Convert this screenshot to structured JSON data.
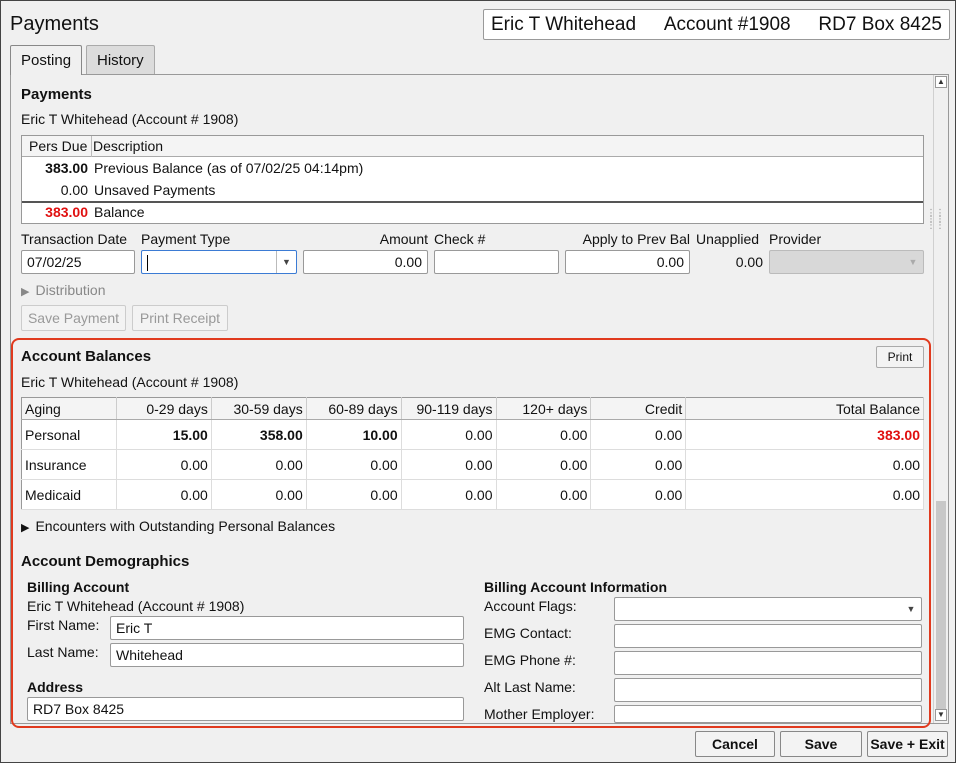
{
  "window_title": "Payments",
  "header": {
    "patient_name": "Eric T Whitehead",
    "account": "Account #1908",
    "address": "RD7 Box 8425"
  },
  "tabs": [
    {
      "label": "Posting"
    },
    {
      "label": "History"
    }
  ],
  "payments": {
    "section_title": "Payments",
    "subtitle": "Eric T Whitehead (Account # 1908)",
    "summary_headers": {
      "pers_due": "Pers Due",
      "description": "Description"
    },
    "summary_rows": [
      {
        "amount": "383.00",
        "description": "Previous Balance (as of 07/02/25 04:14pm)"
      },
      {
        "amount": "0.00",
        "description": "Unsaved Payments"
      },
      {
        "amount": "383.00",
        "description": "Balance"
      }
    ],
    "labels": {
      "transaction_date": "Transaction Date",
      "payment_type": "Payment Type",
      "amount": "Amount",
      "check": "Check #",
      "apply_prev_bal": "Apply to Prev Bal",
      "unapplied": "Unapplied",
      "provider": "Provider"
    },
    "values": {
      "transaction_date": "07/02/25",
      "payment_type": "",
      "amount": "0.00",
      "check": "",
      "apply_prev_bal": "0.00",
      "unapplied": "0.00",
      "provider": ""
    },
    "distribution_label": "Distribution",
    "save_payment_label": "Save Payment",
    "print_receipt_label": "Print Receipt"
  },
  "account_balances": {
    "section_title": "Account Balances",
    "print_label": "Print",
    "subtitle": "Eric T Whitehead (Account # 1908)",
    "columns": [
      "Aging",
      "0-29 days",
      "30-59 days",
      "60-89 days",
      "90-119 days",
      "120+ days",
      "Credit",
      "Total Balance"
    ],
    "rows": [
      {
        "cells": [
          "Personal",
          "15.00",
          "358.00",
          "10.00",
          "0.00",
          "0.00",
          "0.00",
          "383.00"
        ]
      },
      {
        "cells": [
          "Insurance",
          "0.00",
          "0.00",
          "0.00",
          "0.00",
          "0.00",
          "0.00",
          "0.00"
        ]
      },
      {
        "cells": [
          "Medicaid",
          "0.00",
          "0.00",
          "0.00",
          "0.00",
          "0.00",
          "0.00",
          "0.00"
        ]
      }
    ],
    "encounters_label": "Encounters with Outstanding Personal Balances"
  },
  "demographics": {
    "section_title": "Account Demographics",
    "billing_account_title": "Billing Account",
    "billing_account_name": "Eric T Whitehead (Account # 1908)",
    "first_name_label": "First Name:",
    "first_name": "Eric T",
    "last_name_label": "Last Name:",
    "last_name": "Whitehead",
    "address_title": "Address",
    "address": "RD7 Box 8425",
    "info_title": "Billing Account Information",
    "account_flags_label": "Account Flags:",
    "emg_contact_label": "EMG Contact:",
    "emg_phone_label": "EMG Phone #:",
    "alt_last_name_label": "Alt Last Name:",
    "mother_employer_label": "Mother Employer:"
  },
  "footer": {
    "cancel": "Cancel",
    "save": "Save",
    "save_exit": "Save + Exit"
  },
  "colors": {
    "highlight_border": "#e03a1e",
    "negative_red": "#e01010"
  }
}
